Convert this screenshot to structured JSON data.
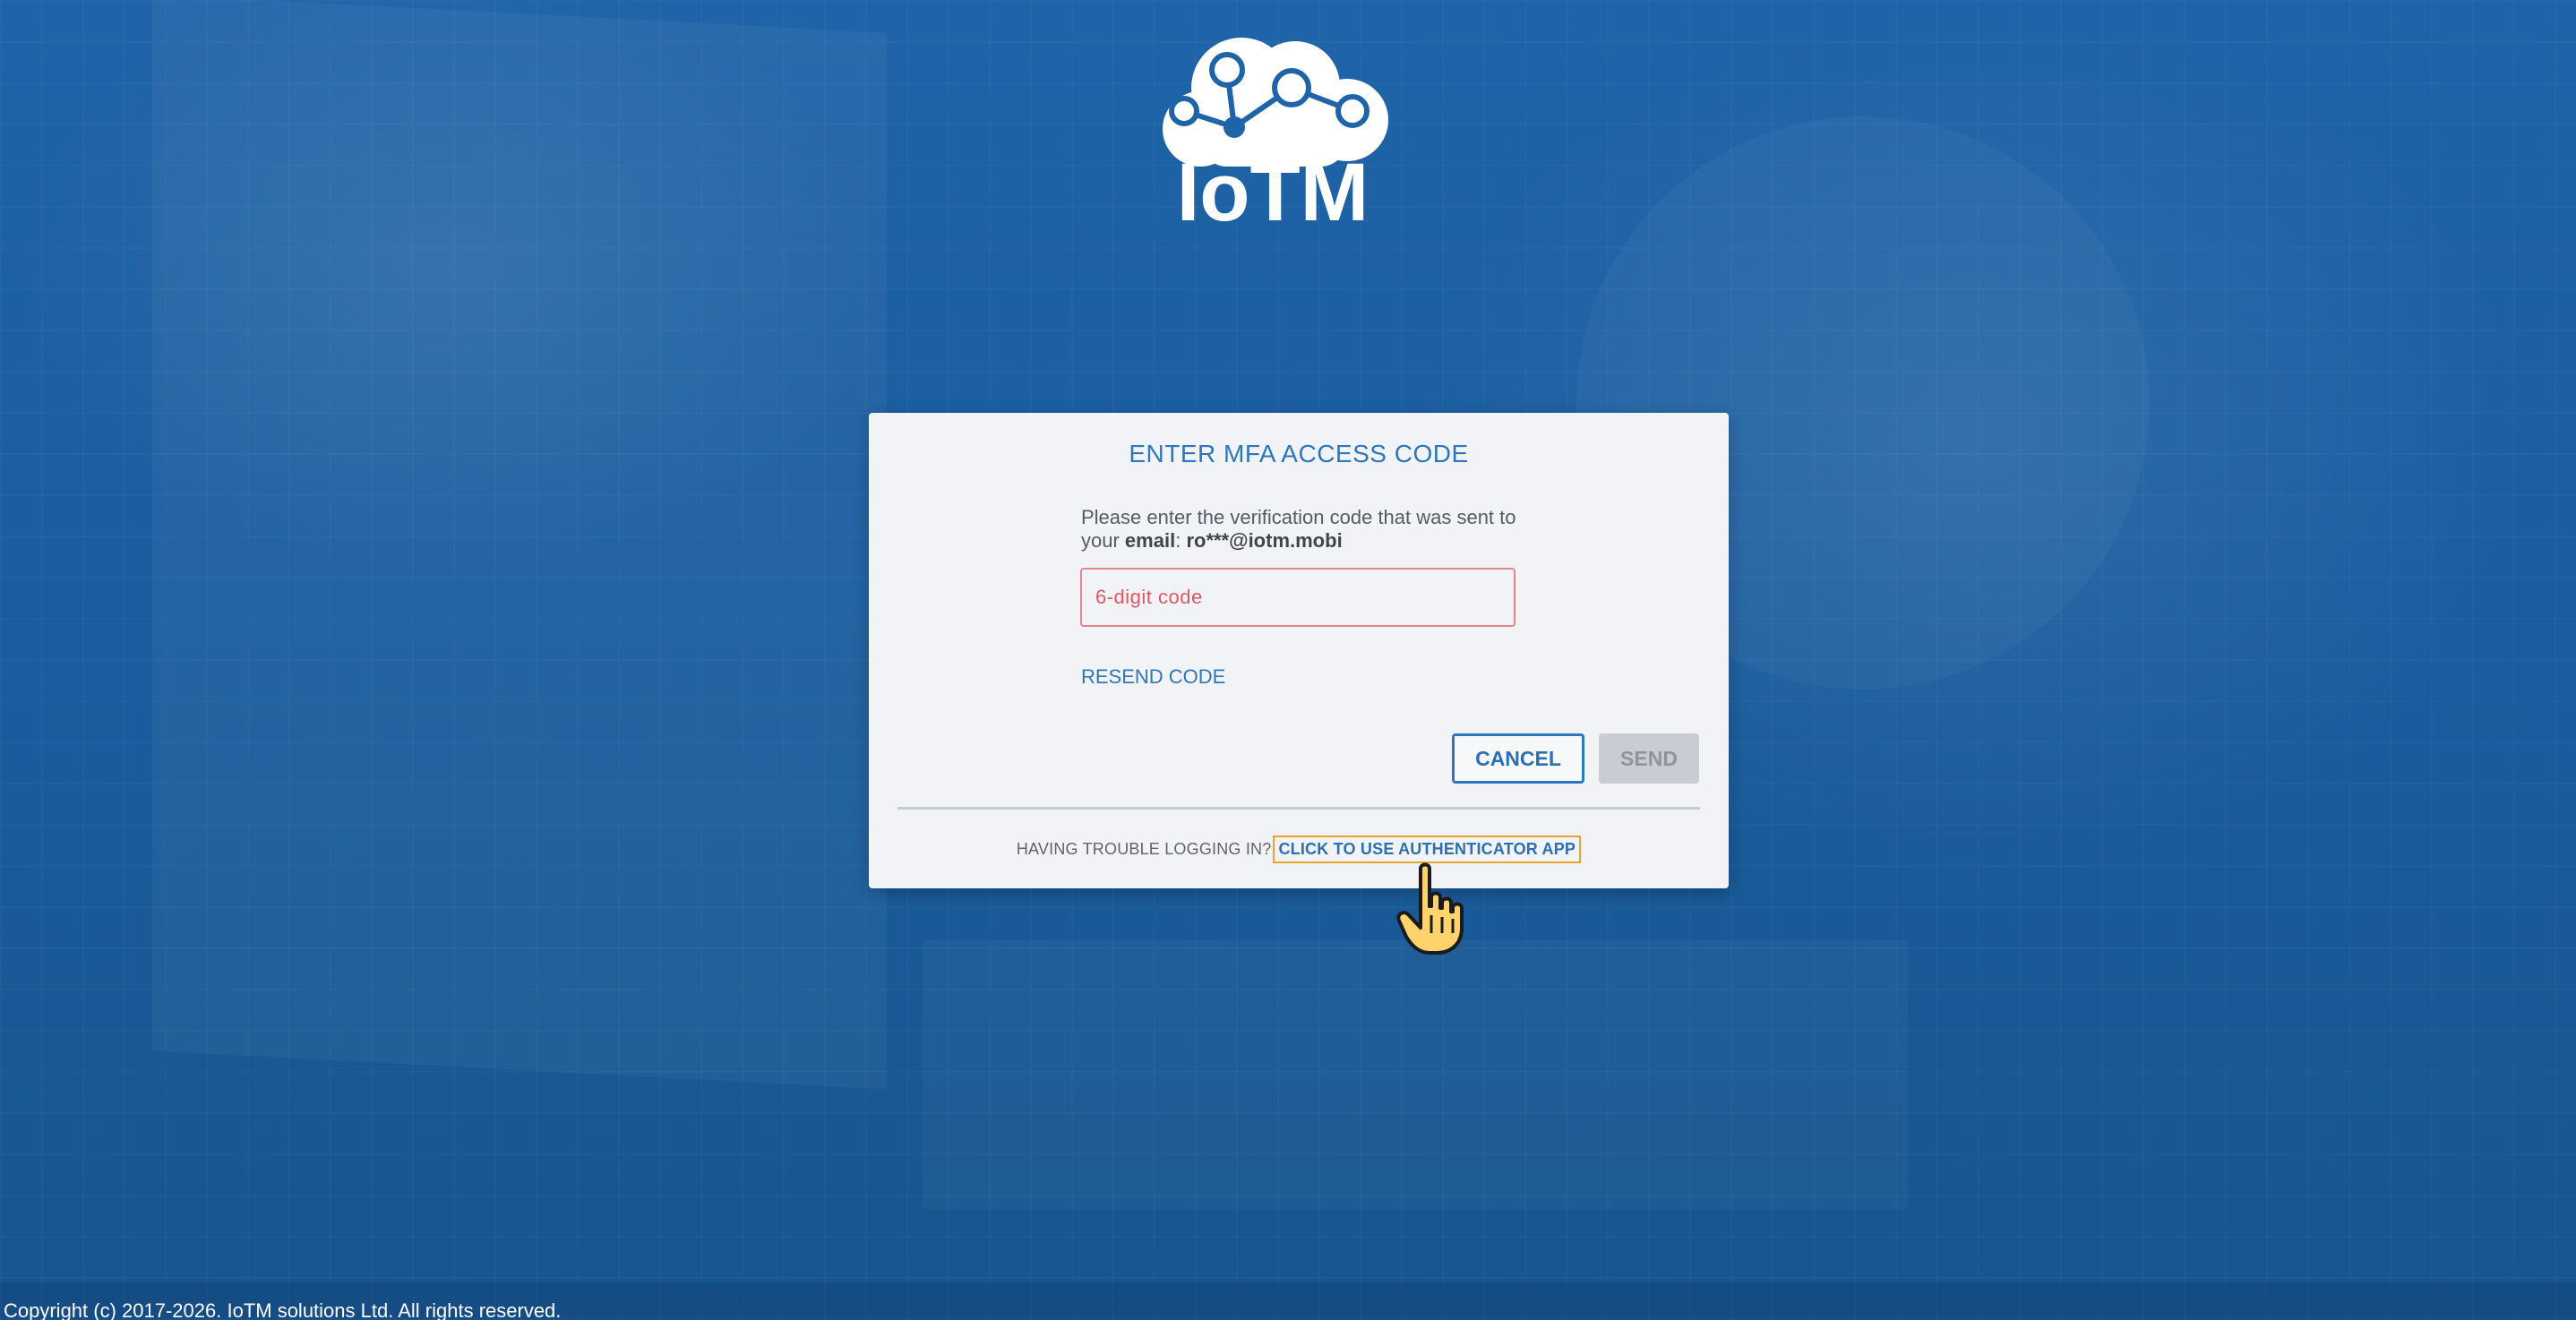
{
  "brand": {
    "name": "IoTM",
    "logo_icon": "cloud-network-icon"
  },
  "dialog": {
    "title": "ENTER MFA ACCESS CODE",
    "instruction_prefix": "Please enter the verification code that was sent to your",
    "instruction_channel": "email",
    "instruction_separator": ":",
    "masked_email": "ro***@iotm.mobi",
    "code_input": {
      "value": "",
      "placeholder": "6-digit code"
    },
    "resend_label": "RESEND CODE",
    "cancel_label": "CANCEL",
    "send_label": "SEND",
    "trouble_text": "HAVING TROUBLE LOGGING IN?",
    "authenticator_link": "CLICK TO USE AUTHENTICATOR APP"
  },
  "cursor": {
    "icon": "hand-pointer-icon"
  },
  "footer": {
    "copyright": "Copyright (c) 2017-2026. IoTM solutions Ltd. All rights reserved."
  },
  "colors": {
    "accent": "#2d77bf",
    "error_border": "#e5848a",
    "error_text": "#e0575f",
    "focus_outline": "#e8a52c",
    "background": "#1a5d9f",
    "card": "#f2f3f6"
  }
}
